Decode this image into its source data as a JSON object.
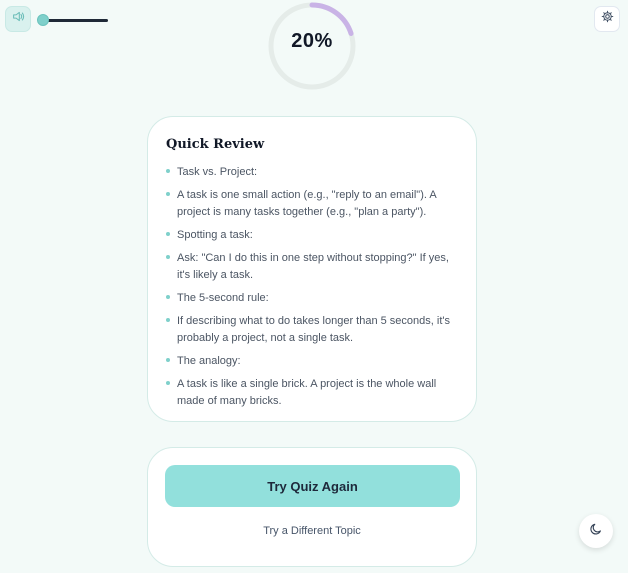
{
  "header": {
    "sound_icon": "speaker-icon",
    "volume": 0.0,
    "settings_icon": "gear-icon"
  },
  "progress": {
    "percent_label": "20%",
    "value": 0.2,
    "accent": "#c9b3e6",
    "track": "#e5ece9"
  },
  "review": {
    "title": "Quick Review",
    "items": [
      "Task vs. Project:",
      "A task is one small action (e.g., \"reply to an email\"). A project is many tasks together (e.g., \"plan a party\").",
      "Spotting a task:",
      "Ask: \"Can I do this in one step without stopping?\" If yes, it's likely a task.",
      "The 5-second rule:",
      "If describing what to do takes longer than 5 seconds, it's probably a project, not a single task.",
      "The analogy:",
      "A task is like a single brick. A project is the whole wall made of many bricks."
    ]
  },
  "actions": {
    "retry_label": "Try Quiz Again",
    "different_topic_label": "Try a Different Topic"
  },
  "theme_toggle_icon": "moon-icon",
  "colors": {
    "accent": "#92e0dc",
    "background": "#f3faf8"
  }
}
